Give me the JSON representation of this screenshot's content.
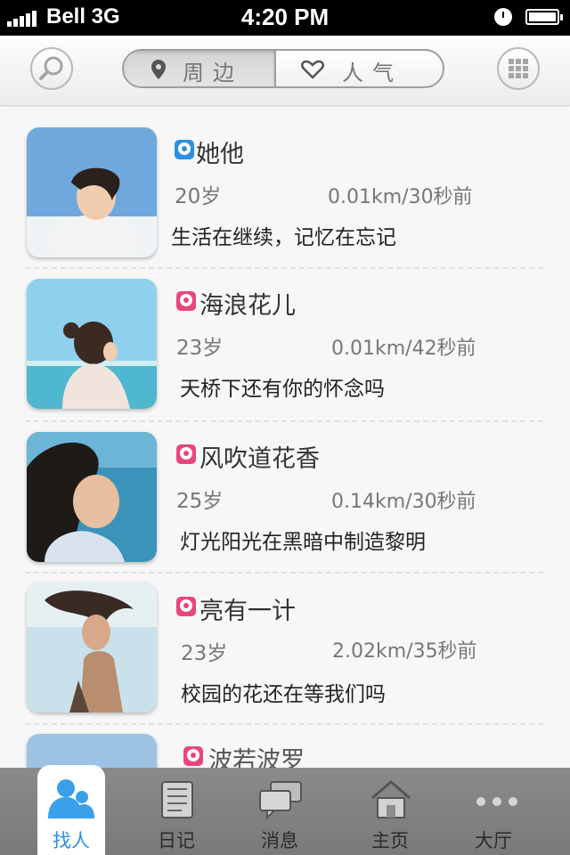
{
  "status_bar": {
    "carrier": "Bell 3G",
    "time": "4:20 PM"
  },
  "nav": {
    "search_icon": "search-icon",
    "segments": [
      {
        "icon": "location-pin-icon",
        "label": "周边",
        "selected": true
      },
      {
        "icon": "heart-icon",
        "label": "人气",
        "selected": false
      }
    ],
    "grid_icon": "grid-icon"
  },
  "users": [
    {
      "name": "她他",
      "gender": "male",
      "age": "20岁",
      "distance_time": "0.01km/30秒前",
      "signature": "生活在继续，记忆在忘记"
    },
    {
      "name": "海浪花儿",
      "gender": "female",
      "age": "23岁",
      "distance_time": "0.01km/42秒前",
      "signature": "天桥下还有你的怀念吗"
    },
    {
      "name": "风吹道花香",
      "gender": "female",
      "age": "25岁",
      "distance_time": "0.14km/30秒前",
      "signature": "灯光阳光在黑暗中制造黎明"
    },
    {
      "name": "亮有一计",
      "gender": "female",
      "age": "23岁",
      "distance_time": "2.02km/35秒前",
      "signature": "校园的花还在等我们吗"
    },
    {
      "name": "波若波罗",
      "gender": "female",
      "age": "",
      "distance_time": "",
      "signature": ""
    }
  ],
  "tabbar": {
    "tabs": [
      {
        "label": "找人",
        "icon": "people-icon",
        "active": true
      },
      {
        "label": "日记",
        "icon": "notebook-icon",
        "active": false
      },
      {
        "label": "消息",
        "icon": "chat-bubbles-icon",
        "active": false
      },
      {
        "label": "主页",
        "icon": "home-icon",
        "active": false
      },
      {
        "label": "大厅",
        "icon": "more-dots-icon",
        "active": false
      }
    ]
  },
  "colors": {
    "accent": "#2e8fe0",
    "female": "#e8467c",
    "tabbar": "#808080"
  }
}
